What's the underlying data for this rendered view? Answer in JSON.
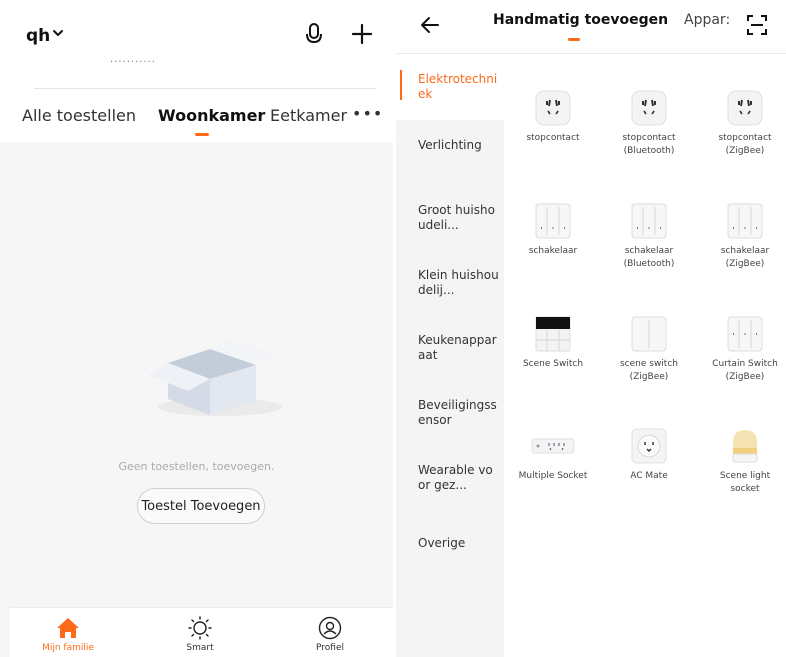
{
  "left": {
    "home_name": "qh",
    "cut_text": "...........",
    "tabs": [
      "Alle toestellen",
      "Woonkamer",
      "Eetkamer"
    ],
    "more": "•••",
    "empty_message": "Geen toestellen, toevoegen.",
    "add_button": "Toestel Toevoegen",
    "nav": [
      "Mijn familie",
      "Smart",
      "Profiel"
    ],
    "accent": "#ff6a1a"
  },
  "right": {
    "title": "Handmatig toevoegen",
    "tab2": "Appar:",
    "categories": [
      "Elektrotechniek",
      "Verlichting",
      "Groot huishoudeli...",
      "Klein huishoudelij...",
      "Keukenapparaat",
      "Beveiligingssensor",
      "Wearable voor gez...",
      "Overige"
    ],
    "devices": [
      {
        "line1": "stopcontact",
        "line2": "",
        "icon": "socket-icon"
      },
      {
        "line1": "stopcontact",
        "line2": "(Bluetooth)",
        "icon": "socket-icon"
      },
      {
        "line1": "stopcontact",
        "line2": "(ZigBee)",
        "icon": "socket-icon"
      },
      {
        "line1": "schakelaar",
        "line2": "",
        "icon": "switch-icon"
      },
      {
        "line1": "schakelaar",
        "line2": "(Bluetooth)",
        "icon": "switch-icon"
      },
      {
        "line1": "schakelaar",
        "line2": "(ZigBee)",
        "icon": "switch-icon"
      },
      {
        "line1": "Scene Switch",
        "line2": "",
        "icon": "scene-switch-icon"
      },
      {
        "line1": "scene switch",
        "line2": "(ZigBee)",
        "icon": "switch-icon"
      },
      {
        "line1": "Curtain Switch",
        "line2": "(ZigBee)",
        "icon": "curtain-switch-icon"
      },
      {
        "line1": "Multiple Socket",
        "line2": "",
        "icon": "power-strip-icon"
      },
      {
        "line1": "AC Mate",
        "line2": "",
        "icon": "ac-mate-icon"
      },
      {
        "line1": "Scene light",
        "line2": "socket",
        "icon": "light-socket-icon"
      }
    ]
  }
}
